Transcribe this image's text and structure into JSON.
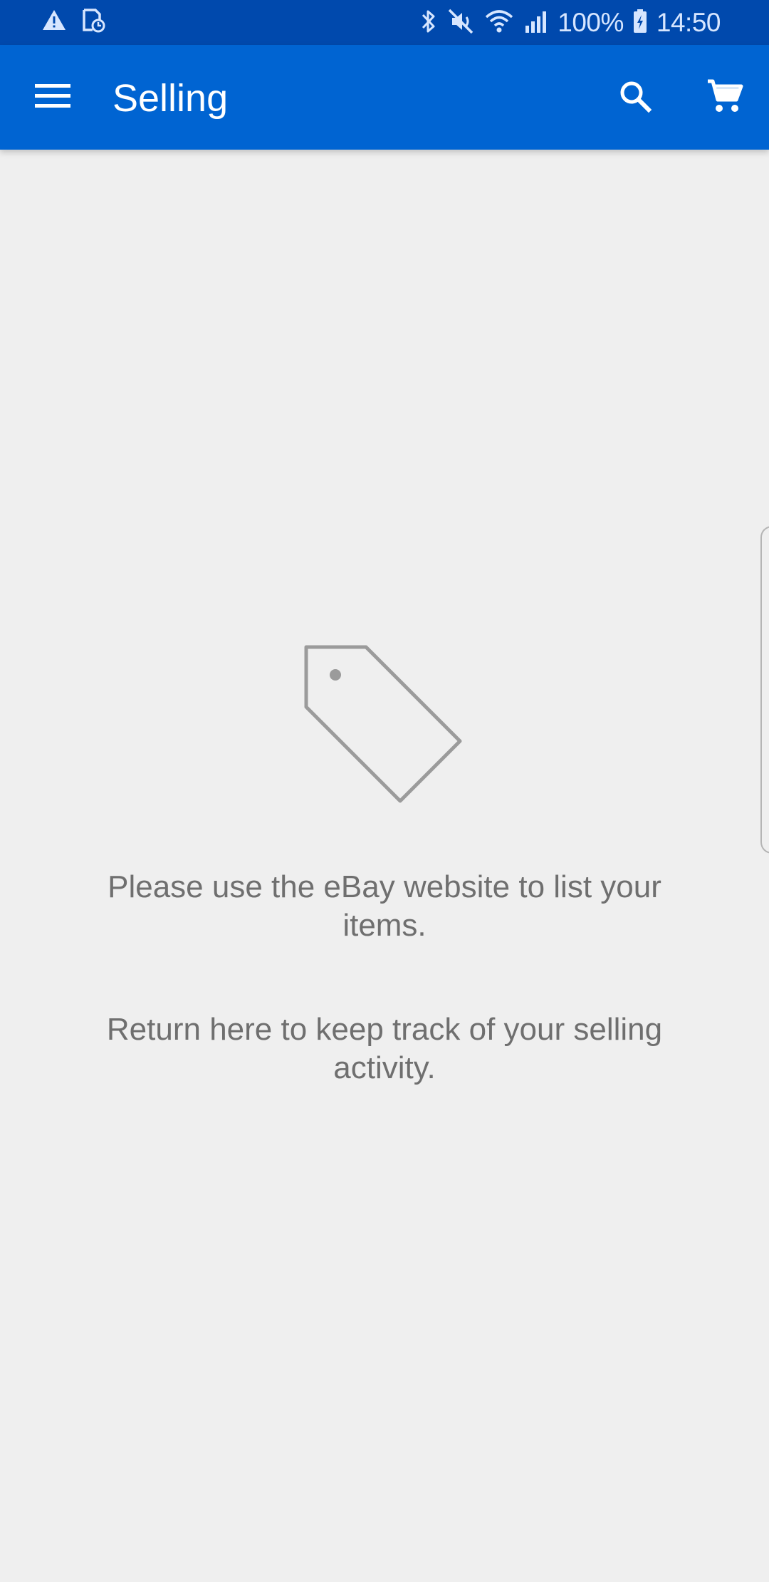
{
  "status_bar": {
    "battery_percent": "100%",
    "time": "14:50",
    "icons": [
      "warning-icon",
      "sim-clock-icon",
      "bluetooth-icon",
      "mute-icon",
      "wifi-icon",
      "signal-icon",
      "battery-charging-icon"
    ],
    "background": "#0049ad"
  },
  "app_bar": {
    "title": "Selling",
    "background": "#0064d2",
    "icons": [
      "menu-icon",
      "search-icon",
      "cart-icon"
    ]
  },
  "empty_state": {
    "icon": "price-tag-icon",
    "message_1": "Please use the eBay website to list your items.",
    "message_2": "Return here to keep track of your selling activity."
  },
  "theme": {
    "page_background": "#efefef",
    "text_gray": "#6f6f6f",
    "white": "#ffffff"
  }
}
